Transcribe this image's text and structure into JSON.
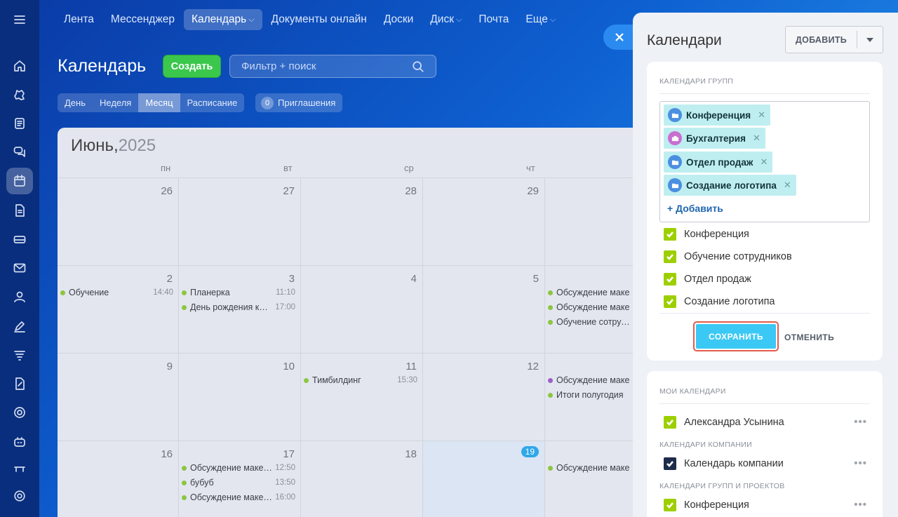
{
  "topnav": {
    "items": [
      {
        "label": "Лента"
      },
      {
        "label": "Мессенджер"
      },
      {
        "label": "Календарь",
        "active": true
      },
      {
        "label": "Документы онлайн"
      },
      {
        "label": "Доски"
      },
      {
        "label": "Диск"
      },
      {
        "label": "Почта"
      },
      {
        "label": "Еще"
      }
    ]
  },
  "sidebar_icons": [
    "menu-icon",
    "home-icon",
    "tasks-icon",
    "feed-icon",
    "chat-icon",
    "calendar-icon",
    "document-icon",
    "drive-icon",
    "mail-icon",
    "contacts-icon",
    "edit-icon",
    "filter-icon",
    "sign-icon",
    "target-icon",
    "robot-icon",
    "shop-icon",
    "settings-icon"
  ],
  "header": {
    "title": "Календарь",
    "create_label": "Создать",
    "search_placeholder": "Фильтр + поиск",
    "view_tabs": [
      {
        "label": "День"
      },
      {
        "label": "Неделя"
      },
      {
        "label": "Месяц",
        "active": true
      },
      {
        "label": "Расписание"
      }
    ],
    "invites_count": "0",
    "invites_label": "Приглашения"
  },
  "calendar": {
    "month": "Июнь,",
    "year": "2025",
    "weekdays": [
      "пн",
      "вт",
      "ср",
      "чт"
    ],
    "weeks": [
      {
        "days": [
          {
            "num": "26",
            "events": []
          },
          {
            "num": "27",
            "events": []
          },
          {
            "num": "28",
            "events": []
          },
          {
            "num": "29",
            "events": []
          },
          {
            "num": "",
            "events": []
          }
        ]
      },
      {
        "days": [
          {
            "num": "2",
            "events": [
              {
                "title": "Обучение",
                "time": "14:40"
              }
            ]
          },
          {
            "num": "3",
            "events": [
              {
                "title": "Планерка",
                "time": "11:10"
              },
              {
                "title": "День рождения к…",
                "time": "17:00"
              }
            ]
          },
          {
            "num": "4",
            "events": []
          },
          {
            "num": "5",
            "events": []
          },
          {
            "num": "",
            "events": [
              {
                "title": "Обсуждение маке",
                "time": ""
              },
              {
                "title": "Обсуждение маке",
                "time": ""
              },
              {
                "title": "Обучение сотруд…",
                "time": ""
              }
            ]
          }
        ]
      },
      {
        "days": [
          {
            "num": "9",
            "events": []
          },
          {
            "num": "10",
            "events": []
          },
          {
            "num": "11",
            "events": [
              {
                "title": "Тимбилдинг",
                "time": "15:30"
              }
            ]
          },
          {
            "num": "12",
            "events": []
          },
          {
            "num": "",
            "events": [
              {
                "title": "Обсуждение маке",
                "time": "",
                "color": "purple"
              },
              {
                "title": "Итоги полугодия",
                "time": ""
              }
            ]
          }
        ]
      },
      {
        "days": [
          {
            "num": "16",
            "events": []
          },
          {
            "num": "17",
            "events": [
              {
                "title": "Обсуждение маке…",
                "time": "12:50"
              },
              {
                "title": "бубуб",
                "time": "13:50"
              },
              {
                "title": "Обсуждение маке…",
                "time": "16:00"
              }
            ]
          },
          {
            "num": "18",
            "events": []
          },
          {
            "num": "19",
            "today": true,
            "events": []
          },
          {
            "num": "",
            "events": [
              {
                "title": "Обсуждение маке",
                "time": ""
              }
            ]
          }
        ]
      }
    ]
  },
  "panel": {
    "title": "Календари",
    "add_label": "ДОБАВИТЬ",
    "group_section_title": "КАЛЕНДАРИ ГРУПП",
    "selected_tags": [
      {
        "label": "Конференция",
        "icon": "folder-icon"
      },
      {
        "label": "Бухгалтерия",
        "icon": "briefcase-icon",
        "color": "#c86fcf"
      },
      {
        "label": "Отдел продаж",
        "icon": "folder-icon"
      },
      {
        "label": "Создание логотипа",
        "icon": "folder-icon"
      }
    ],
    "add_tag_label": "+ Добавить",
    "checkboxes": [
      {
        "label": "Конференция",
        "checked": true
      },
      {
        "label": "Обучение сотрудников",
        "checked": true
      },
      {
        "label": "Отдел продаж",
        "checked": true
      },
      {
        "label": "Создание логотипа",
        "checked": true
      }
    ],
    "save_label": "СОХРАНИТЬ",
    "cancel_label": "ОТМЕНИТЬ",
    "my_section_title": "МОИ КАЛЕНДАРИ",
    "my_calendars": [
      {
        "label": "Александра Усынина"
      }
    ],
    "company_section_title": "КАЛЕНДАРИ КОМПАНИИ",
    "company_calendars": [
      {
        "label": "Календарь компании"
      }
    ],
    "projects_section_title": "КАЛЕНДАРИ ГРУПП И ПРОЕКТОВ",
    "project_calendars": [
      {
        "label": "Конференция"
      }
    ]
  },
  "colors": {
    "accent": "#3bc8f5",
    "create": "#3bc74c",
    "check": "#9dcf00",
    "highlight": "#e25c4b"
  }
}
